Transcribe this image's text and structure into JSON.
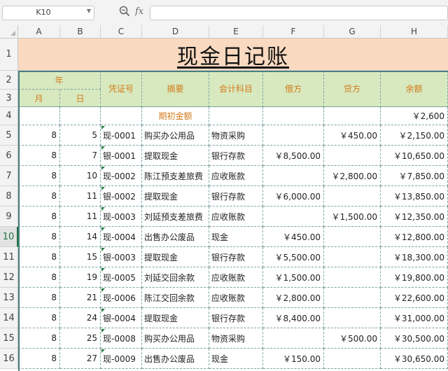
{
  "toolbar": {
    "name_box": "K10",
    "fx_label": "fx",
    "formula_value": ""
  },
  "icons": {
    "zoom": "zoom-magnifier-icon",
    "dropdown": "chevron-down-icon"
  },
  "columns": [
    "A",
    "B",
    "C",
    "D",
    "E",
    "F",
    "G",
    "H"
  ],
  "rows": [
    "1",
    "2",
    "3",
    "4",
    "5",
    "6",
    "7",
    "8",
    "9",
    "10",
    "11",
    "12",
    "13",
    "14",
    "15",
    "16"
  ],
  "active_row": "10",
  "sheet": {
    "title": "现金日记账",
    "header": {
      "year": "年",
      "month": "月",
      "day": "日",
      "voucher": "凭证号",
      "summary": "摘要",
      "account": "会计科目",
      "debit": "借方",
      "credit": "贷方",
      "balance": "余额"
    },
    "opening": {
      "summary": "期初金额",
      "balance": "￥2,600"
    },
    "entries": [
      {
        "month": "8",
        "day": "5",
        "voucher": "现-0001",
        "summary": "购买办公用品",
        "account": "物资采购",
        "debit": "",
        "credit": "￥450.00",
        "balance": "￥2,150.00"
      },
      {
        "month": "8",
        "day": "7",
        "voucher": "银-0001",
        "summary": "提取现金",
        "account": "银行存款",
        "debit": "￥8,500.00",
        "credit": "",
        "balance": "￥10,650.00"
      },
      {
        "month": "8",
        "day": "10",
        "voucher": "现-0002",
        "summary": "陈江预支差旅费",
        "account": "应收账款",
        "debit": "",
        "credit": "￥2,800.00",
        "balance": "￥7,850.00"
      },
      {
        "month": "8",
        "day": "11",
        "voucher": "银-0002",
        "summary": "提取现金",
        "account": "银行存款",
        "debit": "￥6,000.00",
        "credit": "",
        "balance": "￥13,850.00"
      },
      {
        "month": "8",
        "day": "11",
        "voucher": "现-0003",
        "summary": "刘延预支差旅费",
        "account": "应收账款",
        "debit": "",
        "credit": "￥1,500.00",
        "balance": "￥12,350.00"
      },
      {
        "month": "8",
        "day": "14",
        "voucher": "现-0004",
        "summary": "出售办公废品",
        "account": "现金",
        "debit": "￥450.00",
        "credit": "",
        "balance": "￥12,800.00"
      },
      {
        "month": "8",
        "day": "15",
        "voucher": "银-0003",
        "summary": "提取现金",
        "account": "银行存款",
        "debit": "￥5,500.00",
        "credit": "",
        "balance": "￥18,300.00"
      },
      {
        "month": "8",
        "day": "19",
        "voucher": "现-0005",
        "summary": "刘延交回余款",
        "account": "应收账款",
        "debit": "￥1,500.00",
        "credit": "",
        "balance": "￥19,800.00"
      },
      {
        "month": "8",
        "day": "21",
        "voucher": "现-0006",
        "summary": "陈江交回余款",
        "account": "应收账款",
        "debit": "￥2,800.00",
        "credit": "",
        "balance": "￥22,600.00"
      },
      {
        "month": "8",
        "day": "24",
        "voucher": "银-0004",
        "summary": "提取现金",
        "account": "银行存款",
        "debit": "￥8,400.00",
        "credit": "",
        "balance": "￥31,000.00"
      },
      {
        "month": "8",
        "day": "25",
        "voucher": "现-0008",
        "summary": "购买办公用品",
        "account": "物资采购",
        "debit": "",
        "credit": "￥500.00",
        "balance": "￥30,500.00"
      },
      {
        "month": "8",
        "day": "27",
        "voucher": "现-0009",
        "summary": "出售办公废品",
        "account": "现金",
        "debit": "￥150.00",
        "credit": "",
        "balance": "￥30,650.00"
      }
    ]
  },
  "colors": {
    "header_fill": "#d8e9bf",
    "header_text": "#d27b1a",
    "title_fill": "#f9d9bf",
    "active_accent": "#217346"
  }
}
